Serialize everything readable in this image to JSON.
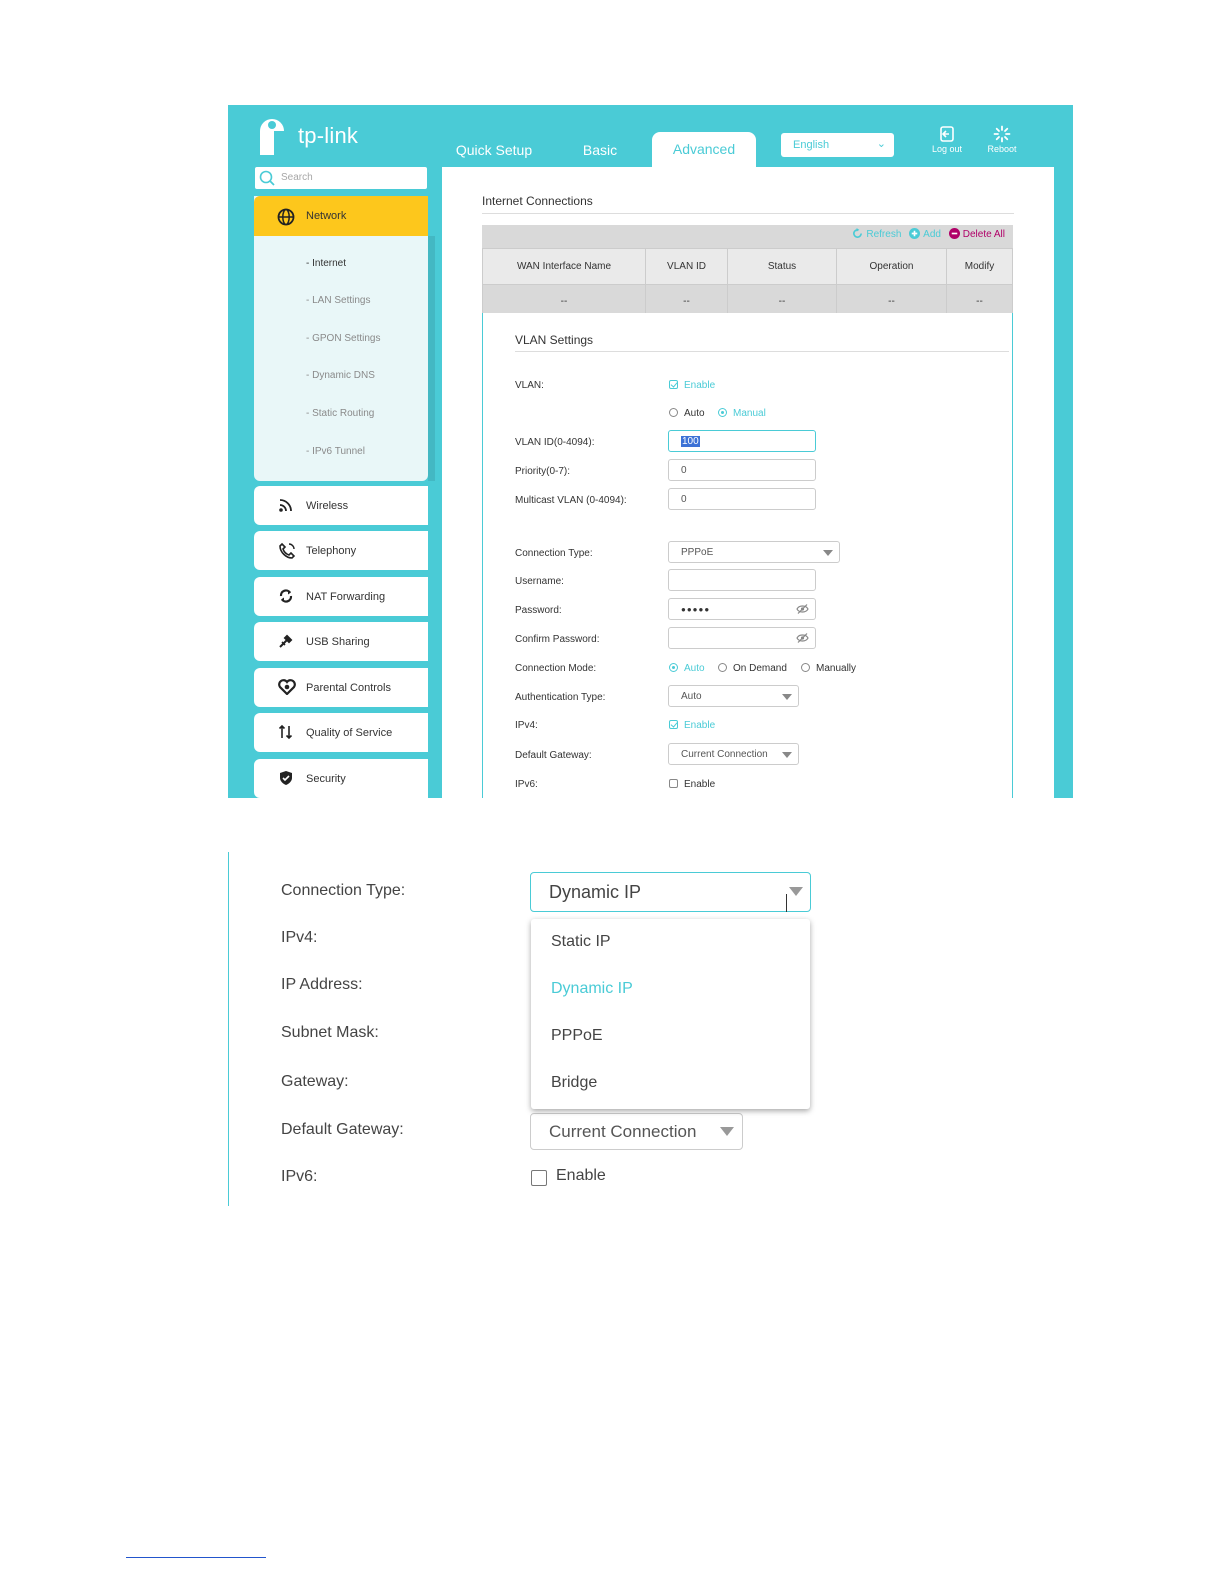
{
  "brand": {
    "name": "tp-link",
    "accent": "#4acbd6",
    "highlight": "#fdc71c"
  },
  "nav_tabs": [
    {
      "label": "Quick Setup",
      "active": false
    },
    {
      "label": "Basic",
      "active": false
    },
    {
      "label": "Advanced",
      "active": true
    }
  ],
  "language": {
    "selected": "English"
  },
  "top_buttons": {
    "logout": "Log out",
    "reboot": "Reboot"
  },
  "sidebar": {
    "search_placeholder": "Search",
    "network": {
      "label": "Network",
      "subitems": [
        "- Internet",
        "- LAN Settings",
        "- GPON Settings",
        "- Dynamic DNS",
        "- Static Routing",
        "- IPv6 Tunnel"
      ]
    },
    "items": [
      {
        "label": "Wireless",
        "icon": "wifi-icon"
      },
      {
        "label": "Telephony",
        "icon": "phone-icon"
      },
      {
        "label": "NAT Forwarding",
        "icon": "nat-icon"
      },
      {
        "label": "USB Sharing",
        "icon": "usb-icon"
      },
      {
        "label": "Parental Controls",
        "icon": "heart-icon"
      },
      {
        "label": "Quality of Service",
        "icon": "qos-icon"
      },
      {
        "label": "Security",
        "icon": "shield-icon"
      }
    ]
  },
  "internet_connections": {
    "title": "Internet Connections",
    "actions": {
      "refresh": "Refresh",
      "add": "Add",
      "delete_all": "Delete All"
    },
    "columns": [
      "WAN Interface Name",
      "VLAN ID",
      "Status",
      "Operation",
      "Modify"
    ],
    "rows": [
      [
        "--",
        "--",
        "--",
        "--",
        "--"
      ]
    ]
  },
  "vlan_settings": {
    "title": "VLAN Settings",
    "vlan_label": "VLAN:",
    "vlan_enable": "Enable",
    "mode_auto": "Auto",
    "mode_manual": "Manual",
    "vlan_id_label": "VLAN ID(0-4094):",
    "vlan_id_value": "100",
    "priority_label": "Priority(0-7):",
    "priority_value": "0",
    "multicast_label": "Multicast VLAN (0-4094):",
    "multicast_value": "0",
    "connection_type_label": "Connection Type:",
    "connection_type_value": "PPPoE",
    "username_label": "Username:",
    "username_value": "",
    "password_label": "Password:",
    "password_value": "●●●●●",
    "confirm_password_label": "Confirm Password:",
    "confirm_password_value": "",
    "connection_mode_label": "Connection Mode:",
    "connection_mode_options": [
      "Auto",
      "On Demand",
      "Manually"
    ],
    "auth_type_label": "Authentication Type:",
    "auth_type_value": "Auto",
    "ipv4_label": "IPv4:",
    "ipv4_enable": "Enable",
    "default_gateway_label": "Default Gateway:",
    "default_gateway_value": "Current Connection",
    "ipv6_label": "IPv6:",
    "ipv6_enable": "Enable"
  },
  "zoom_panel": {
    "connection_type_label": "Connection Type:",
    "connection_type_value": "Dynamic IP",
    "ipv4_label": "IPv4:",
    "ip_address_label": "IP Address:",
    "subnet_mask_label": "Subnet Mask:",
    "gateway_label": "Gateway:",
    "default_gateway_label": "Default Gateway:",
    "default_gateway_value": "Current Connection",
    "ipv6_label": "IPv6:",
    "ipv6_enable": "Enable",
    "dropdown_options": [
      "Static IP",
      "Dynamic IP",
      "PPPoE",
      "Bridge"
    ],
    "dropdown_selected": "Dynamic IP"
  }
}
